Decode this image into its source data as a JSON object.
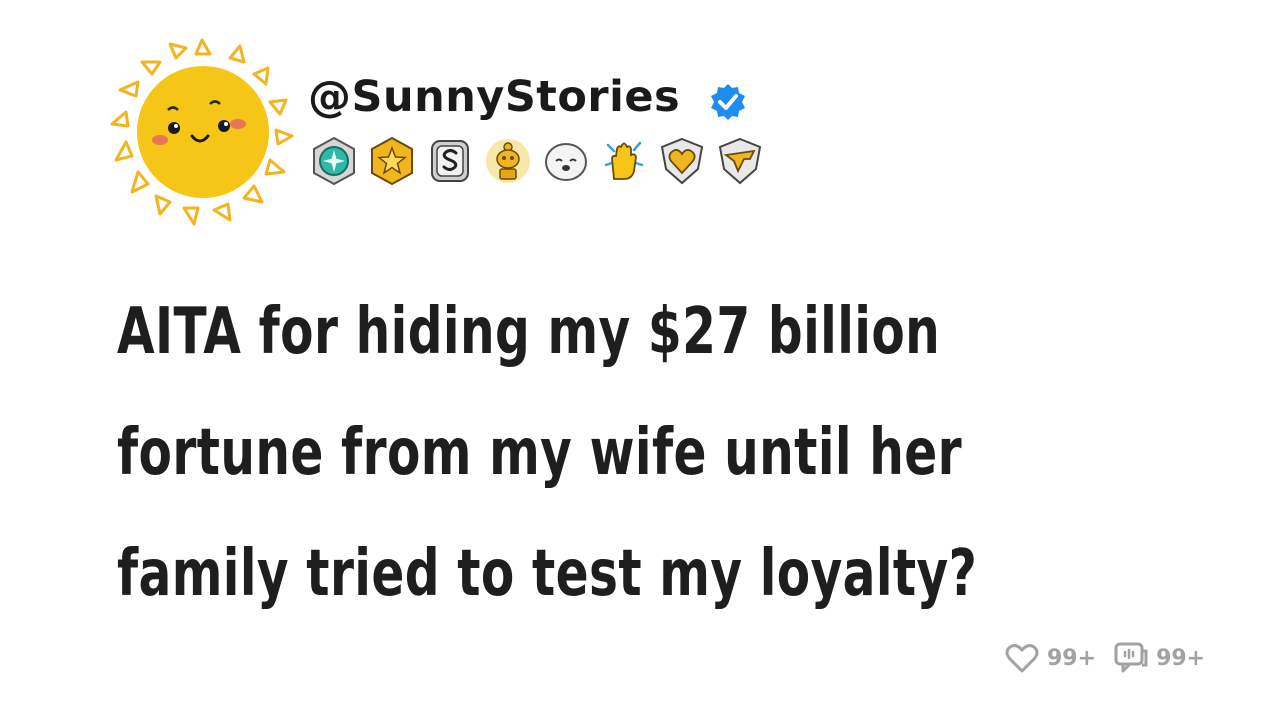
{
  "post": {
    "username": "@SunnyStories",
    "verified": true,
    "title_lines": [
      "AITA for hiding my $27 billion",
      "fortune from my wife until her",
      "family tried to test my loyalty?"
    ]
  },
  "avatar": {
    "icon": "sun-icon",
    "color": "#f5c518"
  },
  "badges": [
    {
      "icon": "teal-compass-badge-icon"
    },
    {
      "icon": "gold-star-badge-icon"
    },
    {
      "icon": "silver-s-badge-icon"
    },
    {
      "icon": "gold-trophy-badge-icon"
    },
    {
      "icon": "seal-badge-icon"
    },
    {
      "icon": "high-five-badge-icon"
    },
    {
      "icon": "gold-heart-shield-badge-icon"
    },
    {
      "icon": "gold-wing-shield-badge-icon"
    }
  ],
  "actions": {
    "likes": "99+",
    "comments": "99+",
    "color": "#a2a2a2"
  }
}
